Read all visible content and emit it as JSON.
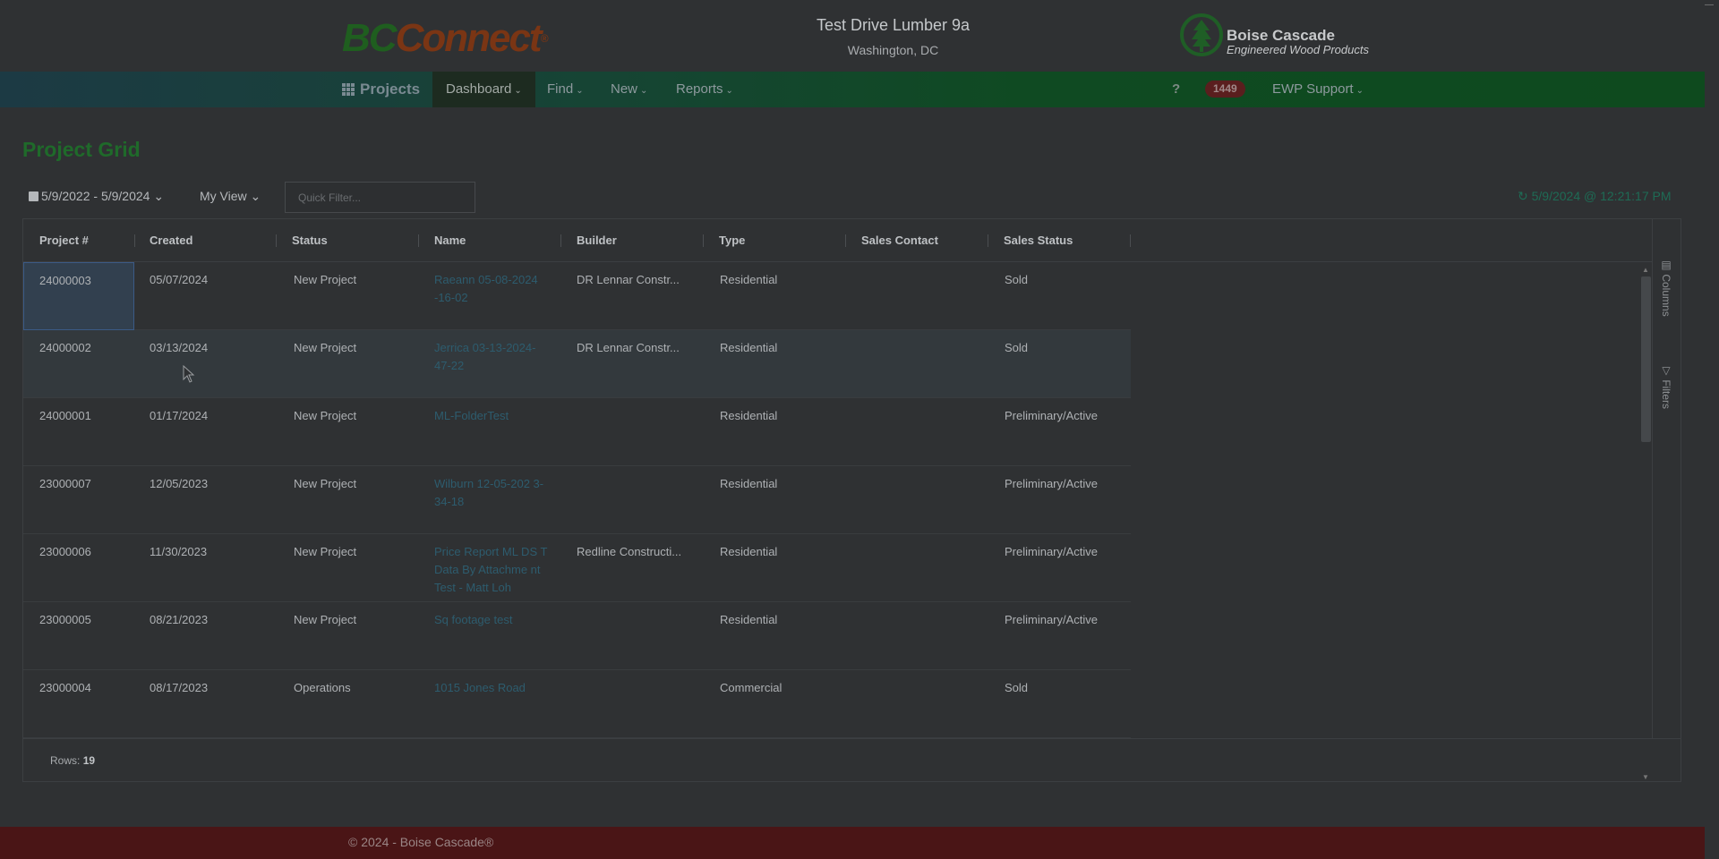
{
  "header": {
    "logo_part1": "BC",
    "logo_part2": "Connect",
    "logo_reg": "®",
    "company_name": "Test Drive Lumber 9a",
    "company_city": "Washington, DC",
    "brand_title": "Boise Cascade",
    "brand_subtitle": "Engineered Wood Products"
  },
  "nav": {
    "brand": "Projects",
    "items": [
      {
        "label": "Dashboard",
        "active": true
      },
      {
        "label": "Find",
        "active": false
      },
      {
        "label": "New",
        "active": false
      },
      {
        "label": "Reports",
        "active": false
      }
    ],
    "help": "?",
    "badge_count": "1449",
    "user_menu": "EWP Support"
  },
  "page": {
    "title": "Project Grid",
    "date_range": "5/9/2022 - 5/9/2024",
    "view": "My View",
    "quick_filter_placeholder": "Quick Filter...",
    "last_refresh": "5/9/2024 @ 12:21:17 PM"
  },
  "grid": {
    "columns": [
      "Project #",
      "Created",
      "Status",
      "Name",
      "Builder",
      "Type",
      "Sales Contact",
      "Sales Status"
    ],
    "rows": [
      {
        "project": "24000003",
        "created": "05/07/2024",
        "status": "New Project",
        "name": "Raeann 05-08-2024 -16-02",
        "builder": "DR Lennar Constr...",
        "type": "Residential",
        "contact": "",
        "sales_status": "Sold"
      },
      {
        "project": "24000002",
        "created": "03/13/2024",
        "status": "New Project",
        "name": "Jerrica 03-13-2024-47-22",
        "builder": "DR Lennar Constr...",
        "type": "Residential",
        "contact": "",
        "sales_status": "Sold"
      },
      {
        "project": "24000001",
        "created": "01/17/2024",
        "status": "New Project",
        "name": "ML-FolderTest",
        "builder": "",
        "type": "Residential",
        "contact": "",
        "sales_status": "Preliminary/Active"
      },
      {
        "project": "23000007",
        "created": "12/05/2023",
        "status": "New Project",
        "name": "Wilburn 12-05-202 3-34-18",
        "builder": "",
        "type": "Residential",
        "contact": "",
        "sales_status": "Preliminary/Active"
      },
      {
        "project": "23000006",
        "created": "11/30/2023",
        "status": "New Project",
        "name": "Price Report ML DS T Data By Attachme nt Test - Matt Loh",
        "builder": "Redline Constructi...",
        "type": "Residential",
        "contact": "",
        "sales_status": "Preliminary/Active"
      },
      {
        "project": "23000005",
        "created": "08/21/2023",
        "status": "New Project",
        "name": "Sq footage test",
        "builder": "",
        "type": "Residential",
        "contact": "",
        "sales_status": "Preliminary/Active"
      },
      {
        "project": "23000004",
        "created": "08/17/2023",
        "status": "Operations",
        "name": "1015 Jones Road",
        "builder": "",
        "type": "Commercial",
        "contact": "",
        "sales_status": "Sold"
      }
    ],
    "side_tabs": [
      "Columns",
      "Filters"
    ],
    "rows_label": "Rows:",
    "rows_count": "19"
  },
  "footer": {
    "copyright": "© 2024 - Boise Cascade®"
  },
  "colors": {
    "nav_green": "#0e4a1e",
    "title_green": "#1f6a2a",
    "footer_red": "#4a1516",
    "badge_red": "#5a1e1e"
  }
}
